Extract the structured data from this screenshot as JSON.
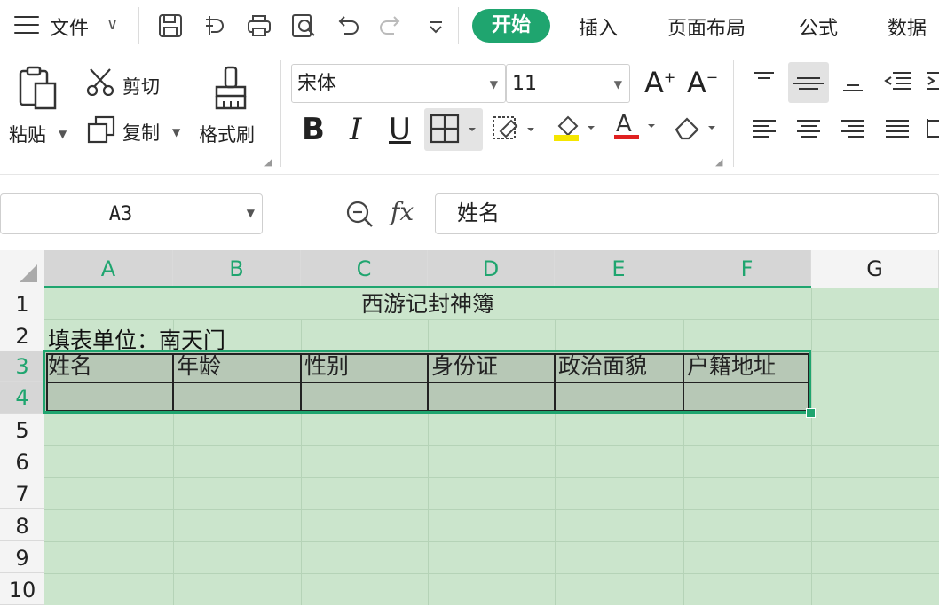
{
  "menubar": {
    "file": "文件",
    "tabs": [
      "开始",
      "插入",
      "页面布局",
      "公式",
      "数据"
    ],
    "active_tab": "开始"
  },
  "ribbon": {
    "paste": "粘贴",
    "cut": "剪切",
    "copy": "复制",
    "format_painter": "格式刷",
    "font_name": "宋体",
    "font_size": "11",
    "bold": "B",
    "italic": "I",
    "underline": "U",
    "grow_font": "A",
    "shrink_font": "A"
  },
  "formula_bar": {
    "name_box": "A3",
    "fx": "fx",
    "content": "姓名"
  },
  "sheet": {
    "columns": [
      "A",
      "B",
      "C",
      "D",
      "E",
      "F",
      "G"
    ],
    "rows": [
      "1",
      "2",
      "3",
      "4",
      "5",
      "6",
      "7",
      "8",
      "9",
      "10"
    ],
    "title": "西游记封神簿",
    "fill_unit": "填表单位：南天门",
    "headers": [
      "姓名",
      "年龄",
      "性别",
      "身份证",
      "政治面貌",
      "户籍地址"
    ],
    "accent_color": "#1fa56f",
    "cell_fill": "#cbe5cc"
  }
}
